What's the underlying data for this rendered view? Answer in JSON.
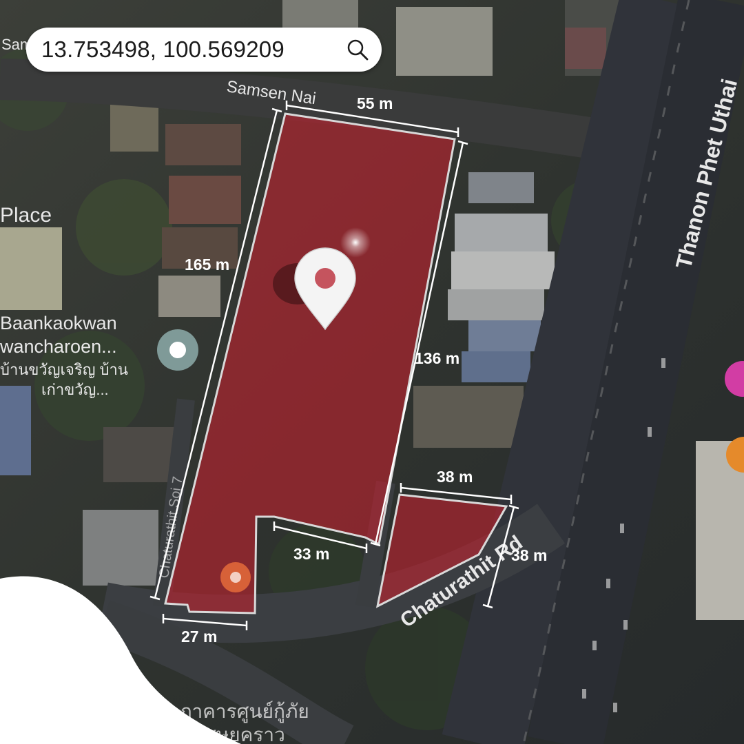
{
  "search": {
    "coordinates": "13.753498, 100.569209"
  },
  "map_labels": {
    "street_top_left": "Sam",
    "street_top": "Samsen Nai",
    "highway": "Thanon Phet Uthai",
    "road": "Chaturathit Rd",
    "soi": "Chaturathit Soi 7",
    "place_partial": "Place",
    "poi_name_en_1": "Baankaokwan",
    "poi_name_en_2": "wancharoen...",
    "poi_name_th_1": "บ้านขวัญเจริญ บ้าน",
    "poi_name_th_2": "เก่าขวัญ...",
    "bottom_th_1": "ภาคารศูนย์กู้ภัย",
    "bottom_th_2": "ผีเศษยคราว"
  },
  "dimensions": {
    "top": "55 m",
    "left": "165 m",
    "right": "136 m",
    "inner": "33 m",
    "bottom": "27 m",
    "small_top": "38 m",
    "small_right": "38 m"
  },
  "icons": [
    "search-icon",
    "location-pin-icon",
    "poi-marker-icon"
  ],
  "colors": {
    "plot_fill": "#c8202f",
    "plot_outline": "#d9d9d9",
    "label": "#ffffff"
  }
}
